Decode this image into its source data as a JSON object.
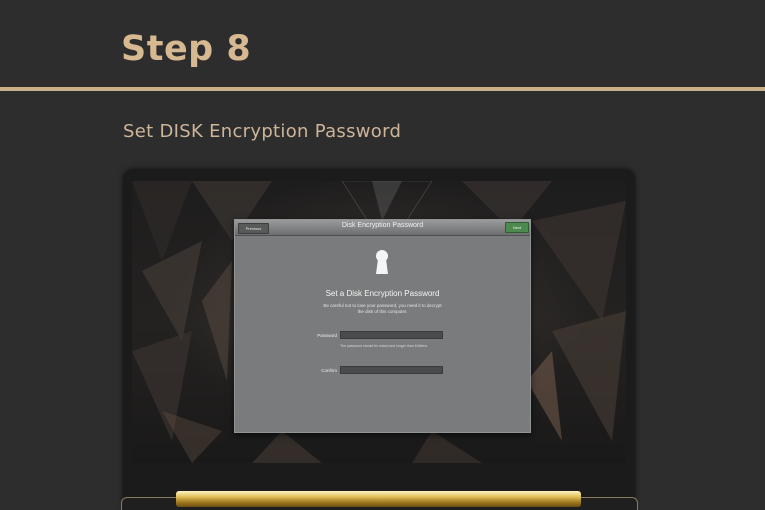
{
  "header": {
    "step_title": "Step 8",
    "subtitle": "Set DISK Encryption Password"
  },
  "dialog": {
    "title": "Disk Encryption Password",
    "previous_label": "Previous",
    "next_label": "Next",
    "heading": "Set a Disk Encryption Password",
    "description": "Be careful not to lose your password, you need it to decrypt the disk of this computer.",
    "password_label": "Password",
    "password_value": "",
    "password_hint": "The password should be mixed and longer than 8 letters",
    "confirm_label": "Confirm",
    "confirm_value": ""
  },
  "colors": {
    "accent_gold": "#d6b991",
    "next_button_green": "#4c8a4f",
    "background": "#2e2d2d"
  },
  "icons": [
    "keyhole-lock-icon"
  ]
}
